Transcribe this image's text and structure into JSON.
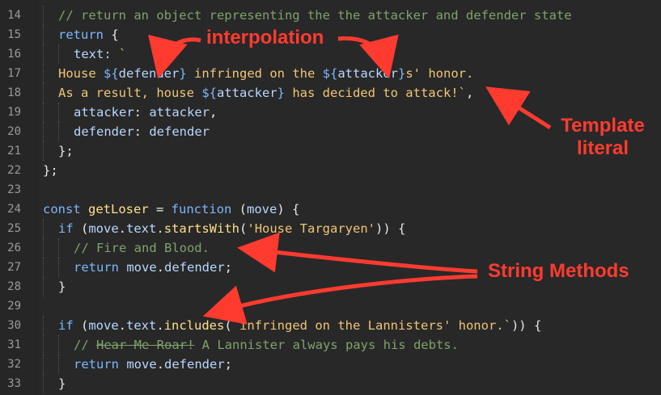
{
  "editor": {
    "lines": [
      {
        "n": "14",
        "code": [
          {
            "t": "// return an object representing the the attacker and defender state",
            "c": "c"
          }
        ],
        "indent": 1
      },
      {
        "n": "15",
        "code": [
          {
            "t": "return",
            "c": "k"
          },
          {
            "t": " {",
            "c": "p"
          }
        ],
        "indent": 1
      },
      {
        "n": "16",
        "code": [
          {
            "t": "text: ",
            "c": "v"
          },
          {
            "t": "`",
            "c": "s"
          }
        ],
        "indent": 2
      },
      {
        "n": "17",
        "code": [
          {
            "t": "House ",
            "c": "s"
          },
          {
            "t": "${",
            "c": "i"
          },
          {
            "t": "defender",
            "c": "v"
          },
          {
            "t": "}",
            "c": "i"
          },
          {
            "t": " infringed on the ",
            "c": "s"
          },
          {
            "t": "${",
            "c": "i"
          },
          {
            "t": "attacker",
            "c": "v"
          },
          {
            "t": "}",
            "c": "i"
          },
          {
            "t": "s' honor.",
            "c": "s"
          }
        ],
        "indent": 1
      },
      {
        "n": "18",
        "code": [
          {
            "t": "As a result, house ",
            "c": "s"
          },
          {
            "t": "${",
            "c": "i"
          },
          {
            "t": "attacker",
            "c": "v"
          },
          {
            "t": "}",
            "c": "i"
          },
          {
            "t": " has decided to attack!`",
            "c": "s"
          },
          {
            "t": ",",
            "c": "p"
          }
        ],
        "indent": 1
      },
      {
        "n": "19",
        "code": [
          {
            "t": "attacker",
            "c": "v"
          },
          {
            "t": ": ",
            "c": "p"
          },
          {
            "t": "attacker",
            "c": "v"
          },
          {
            "t": ",",
            "c": "p"
          }
        ],
        "indent": 2
      },
      {
        "n": "20",
        "code": [
          {
            "t": "defender",
            "c": "v"
          },
          {
            "t": ": ",
            "c": "p"
          },
          {
            "t": "defender",
            "c": "v"
          }
        ],
        "indent": 2
      },
      {
        "n": "21",
        "code": [
          {
            "t": "};",
            "c": "p"
          }
        ],
        "indent": 1
      },
      {
        "n": "22",
        "code": [
          {
            "t": "};",
            "c": "p"
          }
        ],
        "indent": 0
      },
      {
        "n": "23",
        "code": [],
        "indent": 0
      },
      {
        "n": "24",
        "code": [
          {
            "t": "const",
            "c": "k"
          },
          {
            "t": " ",
            "c": "p"
          },
          {
            "t": "getLoser",
            "c": "f"
          },
          {
            "t": " = ",
            "c": "p"
          },
          {
            "t": "function",
            "c": "k"
          },
          {
            "t": " (",
            "c": "p"
          },
          {
            "t": "move",
            "c": "v"
          },
          {
            "t": ") {",
            "c": "p"
          }
        ],
        "indent": 0
      },
      {
        "n": "25",
        "code": [
          {
            "t": "if",
            "c": "k"
          },
          {
            "t": " (",
            "c": "p"
          },
          {
            "t": "move",
            "c": "v"
          },
          {
            "t": ".",
            "c": "p"
          },
          {
            "t": "text",
            "c": "v"
          },
          {
            "t": ".",
            "c": "p"
          },
          {
            "t": "startsWith",
            "c": "f"
          },
          {
            "t": "(",
            "c": "p"
          },
          {
            "t": "'House Targaryen'",
            "c": "s"
          },
          {
            "t": ")) {",
            "c": "p"
          }
        ],
        "indent": 1
      },
      {
        "n": "26",
        "code": [
          {
            "t": "// Fire and Blood.",
            "c": "c"
          }
        ],
        "indent": 2
      },
      {
        "n": "27",
        "code": [
          {
            "t": "return",
            "c": "k"
          },
          {
            "t": " ",
            "c": "p"
          },
          {
            "t": "move",
            "c": "v"
          },
          {
            "t": ".",
            "c": "p"
          },
          {
            "t": "defender",
            "c": "v"
          },
          {
            "t": ";",
            "c": "p"
          }
        ],
        "indent": 2
      },
      {
        "n": "28",
        "code": [
          {
            "t": "}",
            "c": "p"
          }
        ],
        "indent": 1
      },
      {
        "n": "29",
        "code": [],
        "indent": 0
      },
      {
        "n": "30",
        "code": [
          {
            "t": "if",
            "c": "k"
          },
          {
            "t": " (",
            "c": "p"
          },
          {
            "t": "move",
            "c": "v"
          },
          {
            "t": ".",
            "c": "p"
          },
          {
            "t": "text",
            "c": "v"
          },
          {
            "t": ".",
            "c": "p"
          },
          {
            "t": "includes",
            "c": "f"
          },
          {
            "t": "(",
            "c": "p"
          },
          {
            "t": "`infringed on the Lannisters' honor.`",
            "c": "s"
          },
          {
            "t": ")) {",
            "c": "p"
          }
        ],
        "indent": 1
      },
      {
        "n": "31",
        "code": [
          {
            "t": "// ",
            "c": "c"
          },
          {
            "t": "Hear Me Roar!",
            "c": "c strike"
          },
          {
            "t": " A Lannister always pays his debts.",
            "c": "c"
          }
        ],
        "indent": 2
      },
      {
        "n": "32",
        "code": [
          {
            "t": "return",
            "c": "k"
          },
          {
            "t": " ",
            "c": "p"
          },
          {
            "t": "move",
            "c": "v"
          },
          {
            "t": ".",
            "c": "p"
          },
          {
            "t": "defender",
            "c": "v"
          },
          {
            "t": ";",
            "c": "p"
          }
        ],
        "indent": 2
      },
      {
        "n": "33",
        "code": [
          {
            "t": "}",
            "c": "p"
          }
        ],
        "indent": 1
      }
    ]
  },
  "annotations": {
    "interpolation": "interpolation",
    "template_literal_1": "Template",
    "template_literal_2": "literal",
    "string_methods": "String Methods"
  },
  "colors": {
    "annotation": "#ff3b30",
    "background": "#282828"
  }
}
